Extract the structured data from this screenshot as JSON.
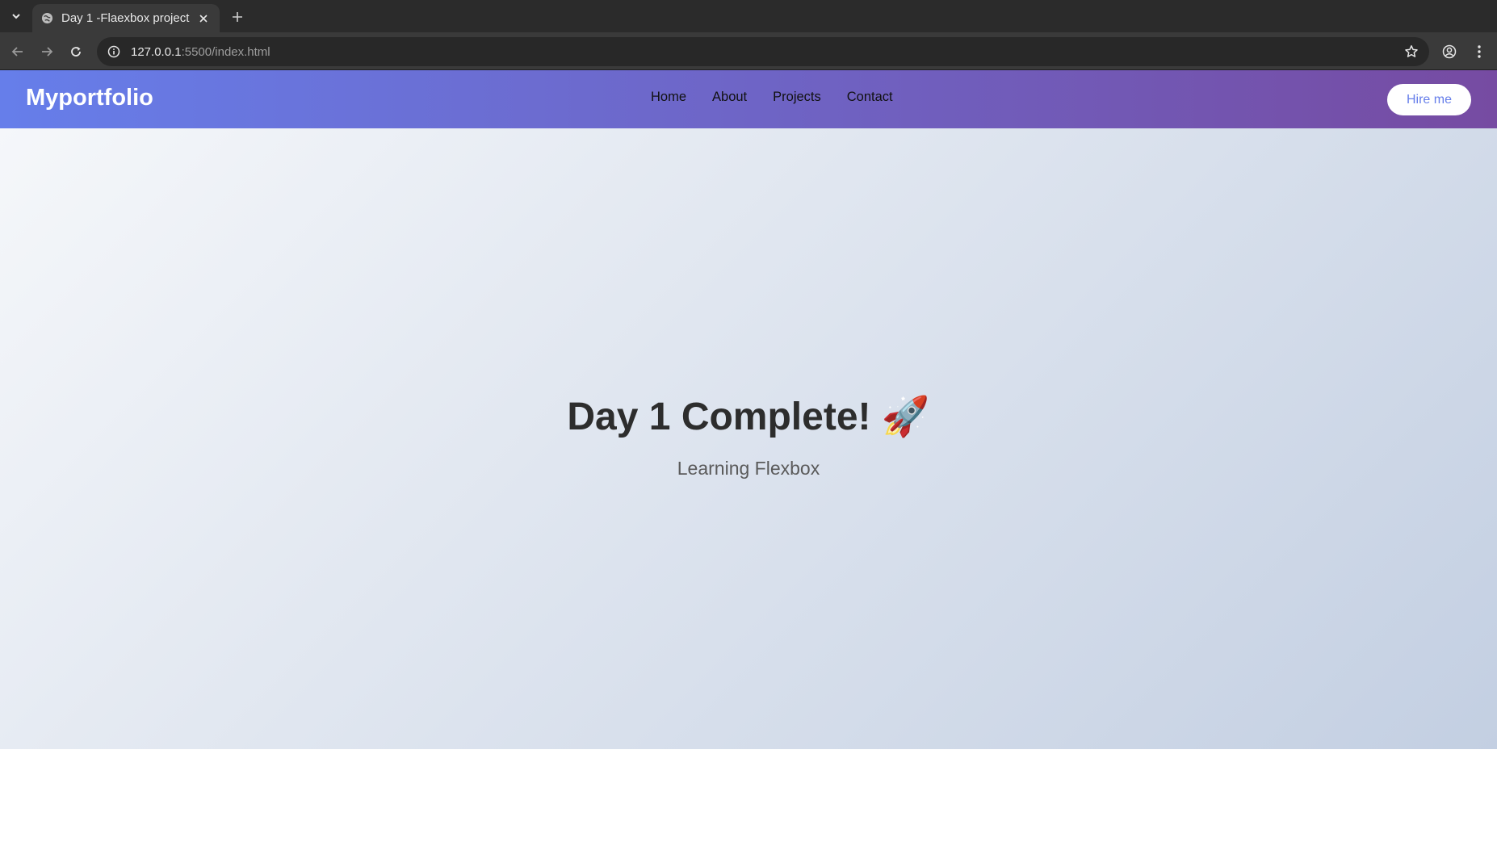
{
  "browser": {
    "tab_title": "Day 1 -Flaexbox project",
    "url_host": "127.0.0.1",
    "url_rest": ":5500/index.html"
  },
  "navbar": {
    "logo": "Myportfolio",
    "links": [
      "Home",
      "About",
      "Projects",
      "Contact"
    ],
    "cta": "Hire me"
  },
  "hero": {
    "title": "Day 1 Complete! 🚀",
    "subtitle": "Learning Flexbox"
  },
  "colors": {
    "nav_gradient_start": "#667eea",
    "nav_gradient_end": "#764ba2",
    "hero_gradient_start": "#f5f7fa",
    "hero_gradient_end": "#c3cfe2",
    "cta_text": "#667eea"
  },
  "icons": [
    "tab-list-icon",
    "globe-icon",
    "close-icon",
    "plus-icon",
    "back-arrow-icon",
    "forward-arrow-icon",
    "reload-icon",
    "info-icon",
    "star-icon",
    "profile-icon",
    "more-vertical-icon"
  ]
}
